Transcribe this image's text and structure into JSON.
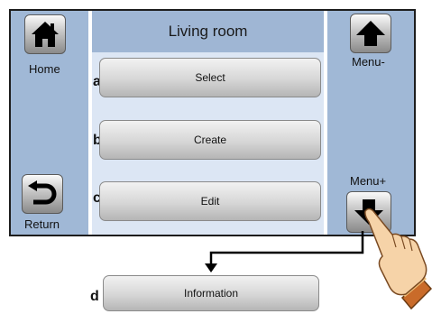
{
  "title": "Living room",
  "left": {
    "home_label": "Home",
    "return_label": "Return"
  },
  "right": {
    "menu_minus_label": "Menu-",
    "menu_plus_label": "Menu+"
  },
  "menu_items": [
    {
      "letter": "a",
      "label": "Select"
    },
    {
      "letter": "b",
      "label": "Create"
    },
    {
      "letter": "c",
      "label": "Edit"
    }
  ],
  "info": {
    "letter": "d",
    "label": "Information"
  },
  "icons": [
    "home-icon",
    "return-icon",
    "arrow-up-icon",
    "arrow-down-icon",
    "pointing-hand-icon"
  ]
}
